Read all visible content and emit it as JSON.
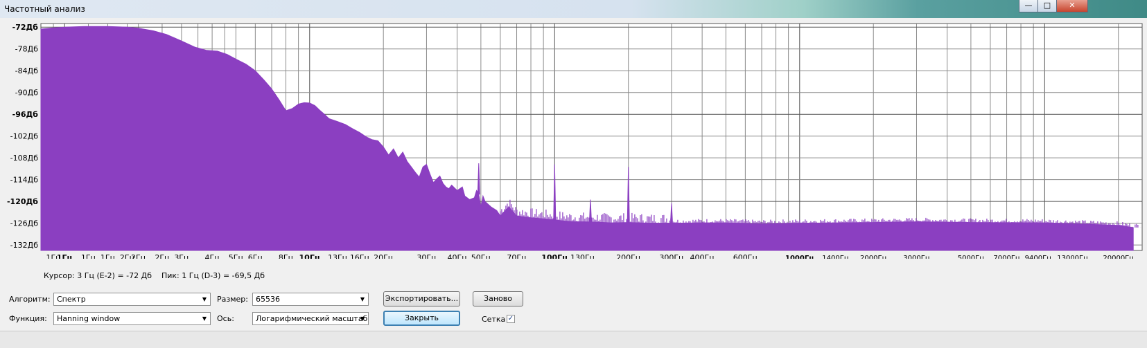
{
  "window": {
    "title": "Частотный анализ",
    "minimize_glyph": "—",
    "maximize_glyph": "□",
    "close_glyph": "✕"
  },
  "colors": {
    "spectrum": "#8b3fc1",
    "grid": "#8a8a8a",
    "plot_bg": "#ffffff"
  },
  "chart_data": {
    "type": "area",
    "title": "",
    "xscale": "log",
    "xlim": [
      0.8,
      25000
    ],
    "ylim": [
      -133.5,
      -71
    ],
    "grid": true,
    "y_ticks": [
      {
        "label": "-72Дб",
        "value": -72,
        "bold": true
      },
      {
        "label": "-78Дб",
        "value": -78,
        "bold": false
      },
      {
        "label": "-84Дб",
        "value": -84,
        "bold": false
      },
      {
        "label": "-90Дб",
        "value": -90,
        "bold": false
      },
      {
        "label": "-96Дб",
        "value": -96,
        "bold": true
      },
      {
        "label": "-102Дб",
        "value": -102,
        "bold": false
      },
      {
        "label": "-108Дб",
        "value": -108,
        "bold": false
      },
      {
        "label": "-114Дб",
        "value": -114,
        "bold": false
      },
      {
        "label": "-120Дб",
        "value": -120,
        "bold": true
      },
      {
        "label": "-126Дб",
        "value": -126,
        "bold": false
      },
      {
        "label": "-132Дб",
        "value": -132,
        "bold": false
      }
    ],
    "x_ticks": [
      {
        "label": "1Гц",
        "value": 0.9,
        "bold": false
      },
      {
        "label": "1Гц",
        "value": 1.0,
        "bold": true
      },
      {
        "label": "1Гц",
        "value": 1.25,
        "bold": false
      },
      {
        "label": "1Гц",
        "value": 1.5,
        "bold": false
      },
      {
        "label": "2Гц",
        "value": 1.8,
        "bold": false
      },
      {
        "label": "2Гц",
        "value": 2.0,
        "bold": false
      },
      {
        "label": "2Гц",
        "value": 2.5,
        "bold": false
      },
      {
        "label": "3Гц",
        "value": 3,
        "bold": false
      },
      {
        "label": "4Гц",
        "value": 4,
        "bold": false
      },
      {
        "label": "5Гц",
        "value": 5,
        "bold": false
      },
      {
        "label": "6Гц",
        "value": 6,
        "bold": false
      },
      {
        "label": "8Гц",
        "value": 8,
        "bold": false
      },
      {
        "label": "10Гц",
        "value": 10,
        "bold": true
      },
      {
        "label": "13Гц",
        "value": 13,
        "bold": false
      },
      {
        "label": "16Гц",
        "value": 16,
        "bold": false
      },
      {
        "label": "20Гц",
        "value": 20,
        "bold": false
      },
      {
        "label": "30Гц",
        "value": 30,
        "bold": false
      },
      {
        "label": "40Гц",
        "value": 40,
        "bold": false
      },
      {
        "label": "50Гц",
        "value": 50,
        "bold": false
      },
      {
        "label": "70Гц",
        "value": 70,
        "bold": false
      },
      {
        "label": "100Гц",
        "value": 100,
        "bold": true
      },
      {
        "label": "130Гц",
        "value": 130,
        "bold": false
      },
      {
        "label": "200Гц",
        "value": 200,
        "bold": false
      },
      {
        "label": "300Гц",
        "value": 300,
        "bold": false
      },
      {
        "label": "400Гц",
        "value": 400,
        "bold": false
      },
      {
        "label": "600Гц",
        "value": 600,
        "bold": false
      },
      {
        "label": "1000Гц",
        "value": 1000,
        "bold": true
      },
      {
        "label": "1400Гц",
        "value": 1400,
        "bold": false
      },
      {
        "label": "2000Гц",
        "value": 2000,
        "bold": false
      },
      {
        "label": "3000Гц",
        "value": 3000,
        "bold": false
      },
      {
        "label": "5000Гц",
        "value": 5000,
        "bold": false
      },
      {
        "label": "7000Гц",
        "value": 7000,
        "bold": false
      },
      {
        "label": "9400Гц",
        "value": 9400,
        "bold": false
      },
      {
        "label": "13000Гц",
        "value": 13000,
        "bold": false
      },
      {
        "label": "20000Гц",
        "value": 20000,
        "bold": false
      }
    ],
    "x_gridlines": [
      0.9,
      1,
      1.25,
      1.5,
      1.8,
      2,
      2.5,
      3,
      3.5,
      4,
      4.5,
      5,
      6,
      7,
      8,
      9,
      10,
      20,
      30,
      40,
      50,
      60,
      70,
      80,
      90,
      100,
      200,
      300,
      400,
      500,
      600,
      700,
      800,
      900,
      1000,
      2000,
      3000,
      4000,
      5000,
      6000,
      7000,
      8000,
      9000,
      10000,
      20000
    ],
    "x_gridlines_major": [
      1,
      10,
      100,
      1000,
      10000
    ],
    "series": [
      {
        "x": [
          0.8,
          0.9,
          1,
          1.2,
          1.5,
          1.8,
          2,
          2.3,
          2.6,
          3,
          3.4,
          3.8,
          4.2,
          4.6,
          5,
          5.5,
          6,
          6.5,
          7,
          7.5,
          8,
          8.5,
          9,
          9.5,
          10,
          10.5,
          11,
          11.5,
          12,
          13,
          14,
          15,
          16,
          17,
          18,
          19,
          20,
          21,
          22,
          23,
          24,
          25,
          26,
          27,
          28,
          29,
          30,
          31,
          32,
          33,
          34,
          35,
          36,
          37,
          38,
          40,
          42,
          43,
          45,
          47,
          48,
          49,
          50,
          51,
          52,
          55,
          58,
          60,
          65,
          70,
          80,
          90,
          100,
          110,
          120,
          130,
          150,
          170,
          200,
          250,
          300,
          400,
          500,
          700,
          1000,
          2000,
          3000,
          5000,
          10000,
          20000,
          23000
        ],
        "y": [
          -72.5,
          -72.2,
          -72,
          -71.8,
          -71.8,
          -72,
          -72.3,
          -73,
          -74,
          -75.8,
          -77.5,
          -78.4,
          -78.6,
          -79.5,
          -80.8,
          -82.2,
          -84,
          -86.5,
          -89,
          -92,
          -95,
          -94.4,
          -93.2,
          -92.8,
          -92.9,
          -93.6,
          -94.9,
          -96,
          -97.2,
          -98,
          -98.8,
          -100,
          -101,
          -102.2,
          -103,
          -103.3,
          -105,
          -107.2,
          -105.5,
          -108,
          -106.4,
          -109,
          -110.5,
          -112,
          -113.3,
          -110.5,
          -109.8,
          -112.5,
          -114.8,
          -113.8,
          -113,
          -115,
          -116,
          -116.5,
          -115.5,
          -117,
          -116,
          -118.5,
          -119.5,
          -119,
          -117,
          -118,
          -121.5,
          -118.5,
          -120,
          -121.5,
          -122.5,
          -124,
          -121.5,
          -124,
          -124.5,
          -124.8,
          -125.1,
          -125.4,
          -125.6,
          -125.6,
          -125.7,
          -125.9,
          -125.8,
          -126,
          -126,
          -125.9,
          -125.9,
          -126.2,
          -126,
          -125.8,
          -125.6,
          -125.8,
          -125.9,
          -126.6,
          -127.2
        ]
      }
    ],
    "peaks": [
      {
        "x": 49,
        "y": -109.5
      },
      {
        "x": 100,
        "y": -109.8
      },
      {
        "x": 140,
        "y": -119.5
      },
      {
        "x": 200,
        "y": -110.5
      },
      {
        "x": 300,
        "y": -120.5
      }
    ]
  },
  "status": {
    "text": "Курсор: 3 Гц (E-2) = -72 Дб    Пик: 1 Гц (D-3) = -69,5 Дб"
  },
  "controls": {
    "algorithm_label": "Алгоритм:",
    "algorithm_value": "Спектр",
    "function_label": "Функция:",
    "function_value": "Hanning window",
    "size_label": "Размер:",
    "size_value": "65536",
    "axis_label": "Ось:",
    "axis_value": "Логарифмический масштаб",
    "export_label": "Экспортировать...",
    "reset_label": "Заново",
    "close_label": "Закрыть",
    "grid_label": "Сетка",
    "grid_checked": "✓",
    "dropdown_arrow": "▼"
  }
}
